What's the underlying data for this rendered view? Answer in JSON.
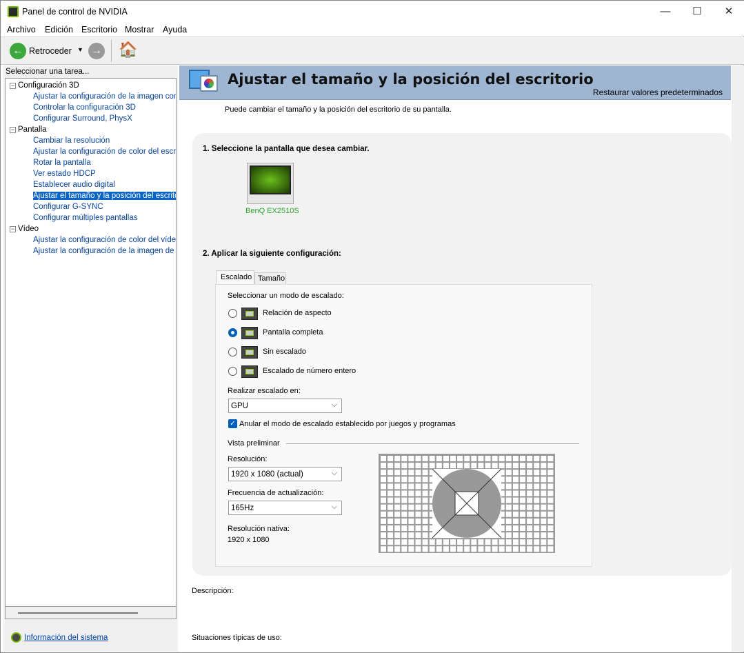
{
  "window": {
    "title": "Panel de control de NVIDIA",
    "minimize": "—",
    "maximize": "☐",
    "close": "✕"
  },
  "menu": [
    "Archivo",
    "Edición",
    "Escritorio",
    "Mostrar",
    "Ayuda"
  ],
  "toolbar": {
    "back_label": "Retroceder"
  },
  "sidebar": {
    "heading": "Seleccionar una tarea...",
    "groups": [
      {
        "label": "Configuración 3D",
        "items": [
          "Ajustar la configuración de la imagen con v",
          "Controlar la configuración 3D",
          "Configurar Surround, PhysX"
        ]
      },
      {
        "label": "Pantalla",
        "items": [
          "Cambiar la resolución",
          "Ajustar la configuración de color del escrito",
          "Rotar la pantalla",
          "Ver estado HDCP",
          "Establecer audio digital",
          "Ajustar el tamaño y la posición del escritorio",
          "Configurar G-SYNC",
          "Configurar múltiples pantallas"
        ]
      },
      {
        "label": "Vídeo",
        "items": [
          "Ajustar la configuración de color del vídeo",
          "Ajustar la configuración de la imagen de víd"
        ]
      }
    ],
    "selected": "Ajustar el tamaño y la posición del escritorio",
    "system_info": "Información del sistema"
  },
  "page": {
    "title": "Ajustar el tamaño y la posición del escritorio",
    "restore": "Restaurar valores predeterminados",
    "subtitle": "Puede cambiar el tamaño y la posición del escritorio de su pantalla.",
    "step1": "1. Seleccione la pantalla que desea cambiar.",
    "display_name": "BenQ EX2510S",
    "step2": "2. Aplicar la siguiente configuración:",
    "tabs": [
      "Escalado",
      "Tamaño"
    ],
    "mode_label": "Seleccionar un modo de escalado:",
    "modes": [
      {
        "label": "Relación de aspecto",
        "checked": false
      },
      {
        "label": "Pantalla completa",
        "checked": true
      },
      {
        "label": "Sin escalado",
        "checked": false
      },
      {
        "label": "Escalado de número entero",
        "checked": false
      }
    ],
    "perform_label": "Realizar escalado en:",
    "perform_value": "GPU",
    "override_label": "Anular el modo de escalado establecido por juegos y programas",
    "override_checked": true,
    "preview_label": "Vista preliminar",
    "resolution_label": "Resolución:",
    "resolution_value": "1920 x 1080 (actual)",
    "refresh_label": "Frecuencia de actualización:",
    "refresh_value": "165Hz",
    "native_label": "Resolución nativa:",
    "native_value": "1920 x 1080",
    "description_label": "Descripción:",
    "usage_label": "Situaciones típicas de uso:"
  },
  "colors": {
    "accent": "#0a64c8",
    "nvidia_green": "#76b900",
    "header": "#9fb6d3",
    "link": "#0645ad"
  }
}
